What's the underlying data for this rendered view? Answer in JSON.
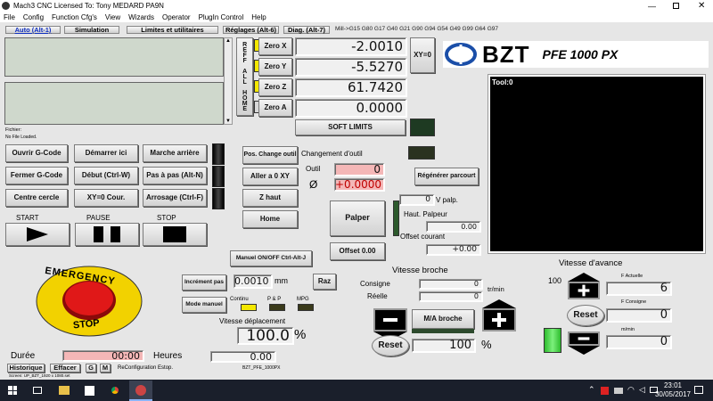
{
  "titlebar": {
    "title": "Mach3 CNC  Licensed To: Tony MEDARD PA9N"
  },
  "menu": [
    "File",
    "Config",
    "Function Cfg's",
    "View",
    "Wizards",
    "Operator",
    "PlugIn Control",
    "Help"
  ],
  "tabs": [
    "Auto (Alt-1)",
    "Simulation",
    "Limites et utilitaires",
    "Réglages (Alt-6)",
    "Diag. (Alt-7)"
  ],
  "gcode_line": "Mill->G15  G80 G17 G40 G21 G90 G94 G54 G49 G99 G64 G97",
  "file": {
    "label": "Fichier:",
    "value": "No File Loaded."
  },
  "ref_home": "REFF ALL HOME",
  "axes": [
    {
      "label": "Zero X",
      "value": "-2.0010"
    },
    {
      "label": "Zero Y",
      "value": "-5.5270"
    },
    {
      "label": "Zero Z",
      "value": "61.7420"
    },
    {
      "label": "Zero A",
      "value": "0.0000"
    }
  ],
  "xy0": "XY=0",
  "soft_limits": "SOFT    LIMITS",
  "logo": {
    "brand": "BZT",
    "model": "PFE 1000 PX"
  },
  "tool_display": "Tool:0",
  "buttons": {
    "open": "Ouvrir G-Code",
    "start_here": "Démarrer ici",
    "reverse": "Marche arrière",
    "close": "Fermer G-Code",
    "beginning": "Début (Ctrl-W)",
    "step": "Pas à pas (Alt-N)",
    "center": "Centre cercle",
    "xy0cur": "XY=0 Cour.",
    "spray": "Arrosage (Ctrl-F)",
    "tool_change_pos": "Pos. Change outil",
    "goto_xy0": "Aller a 0 XY",
    "z_high": "Z haut",
    "home": "Home",
    "palper": "Palper",
    "offset": "Offset 0.00",
    "regen": "Régénérer parcourt",
    "manual_onoff": "Manuel ON/OFF Ctrl-Alt-J",
    "incr_step": "Incrément pas",
    "manual_mode": "Mode manuel",
    "raz": "Raz",
    "ma_broche": "M/A broche",
    "reset": "Reset",
    "history": "Historique",
    "clear": "Effacer",
    "g": "G",
    "m": "M"
  },
  "tool_change": "Changement d'outil",
  "tool": {
    "label": "Outil",
    "value": "0",
    "diam_symbol": "Ø",
    "diam_value": "+0.0000"
  },
  "probe": {
    "v_value": "0",
    "v_label": "V palp.",
    "height_label": "Haut. Palpeur",
    "height_value": "0.00",
    "offset_label": "Offset courant",
    "offset_value": "+0.00"
  },
  "controls": {
    "start": "START",
    "pause": "PAUSE",
    "stop": "STOP"
  },
  "emergency": {
    "top": "EMERGENCY",
    "bottom": "STOP"
  },
  "increment": {
    "value": "0.0010",
    "unit": "mm"
  },
  "modes": {
    "continu": "Continu",
    "pp": "P & P",
    "mpg": "MPG"
  },
  "jog": {
    "label": "Vitesse déplacement",
    "value": "100.0",
    "unit": "%",
    "extra": "0.00",
    "profile": "BZT_PFE_1000PX"
  },
  "spindle": {
    "title": "Vitesse broche",
    "consigne_label": "Consigne",
    "consigne": "0",
    "reelle_label": "Réelle",
    "reelle": "0",
    "unit": "tr/min",
    "percent": "100",
    "percent_unit": "%"
  },
  "feed": {
    "title": "Vitesse d'avance",
    "pct": "100",
    "actuelle_label": "F Actuelle",
    "actuelle": "6",
    "consigne_label": "F Consigne",
    "consigne": "0",
    "mmin_label": "m/min",
    "mmin": "0"
  },
  "duration": {
    "label": "Durée",
    "value": "00:00",
    "unit": "Heures"
  },
  "reconfig": "ReConfiguration Estop.",
  "screen_info": "Screen: UP_BZT_1920 x 1080.set",
  "taskbar": {
    "time": "23:01",
    "date": "30/05/2017"
  }
}
